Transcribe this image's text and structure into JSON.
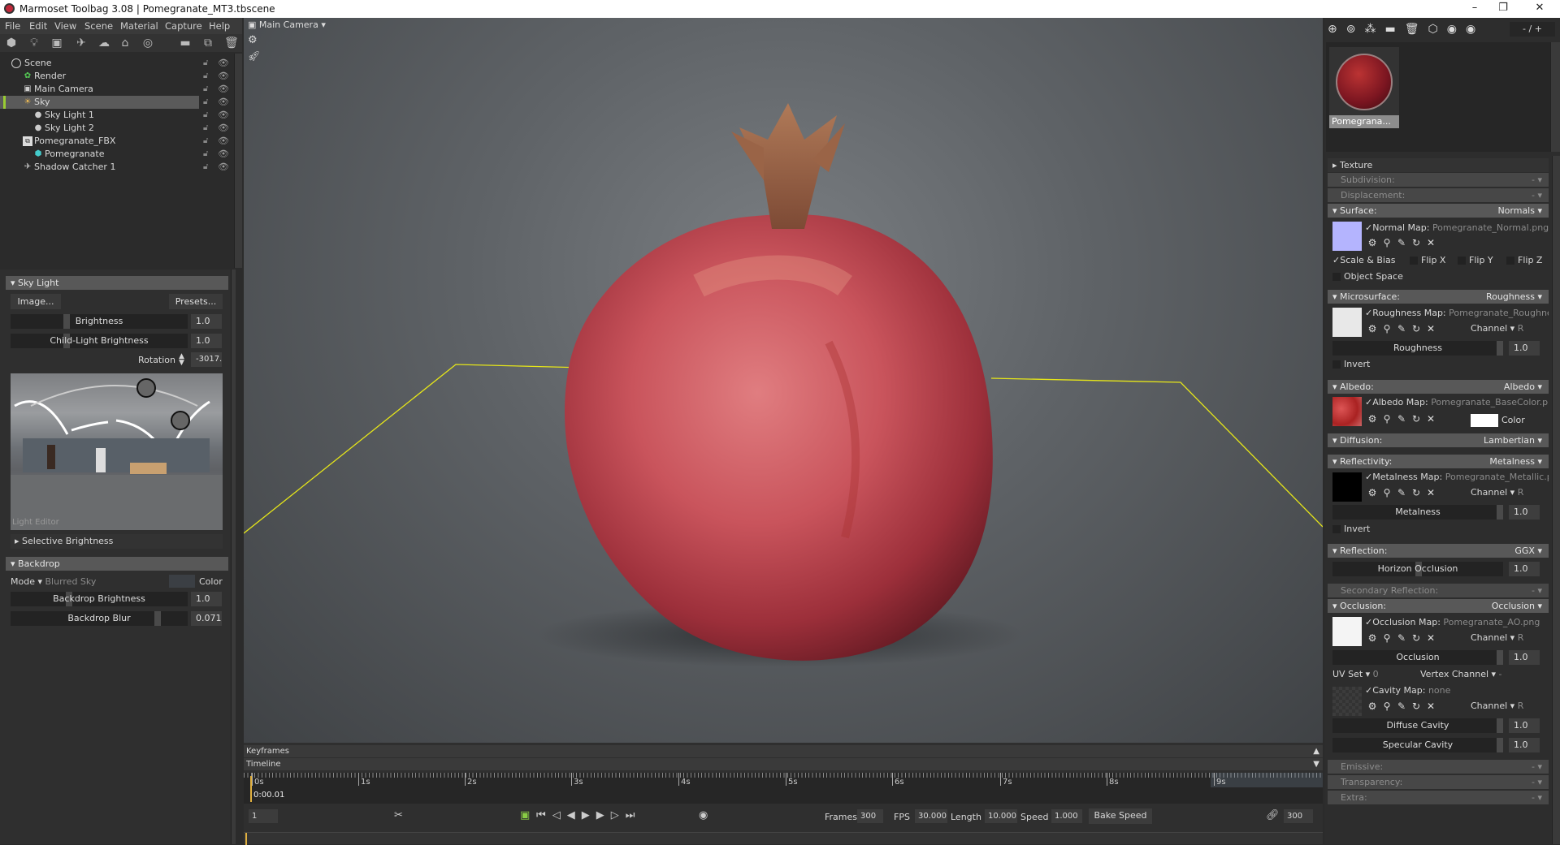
{
  "window": {
    "title": "Marmoset Toolbag 3.08  |  Pomegranate_MT3.tbscene",
    "minimize": "–",
    "restore": "❐",
    "close": "✕"
  },
  "menu": [
    "File",
    "Edit",
    "View",
    "Scene",
    "Material",
    "Capture",
    "Help"
  ],
  "scene_tree": [
    {
      "label": "Scene",
      "icon": "scene-icon"
    },
    {
      "label": "Render",
      "icon": "render-gear-icon"
    },
    {
      "label": "Main Camera",
      "icon": "camera-icon"
    },
    {
      "label": "Sky",
      "icon": "sky-icon",
      "selected": true
    },
    {
      "label": "Sky Light 1",
      "icon": "light-bulb-icon"
    },
    {
      "label": "Sky Light 2",
      "icon": "light-bulb-icon"
    },
    {
      "label": "Pomegranate_FBX",
      "icon": "fbx-icon"
    },
    {
      "label": "Pomegranate",
      "icon": "mesh-icon"
    },
    {
      "label": "Shadow Catcher 1",
      "icon": "shadow-catcher-icon"
    }
  ],
  "sky_light": {
    "title": "Sky Light",
    "image_btn": "Image...",
    "presets_btn": "Presets...",
    "brightness_label": "Brightness",
    "brightness": "1.0",
    "child_label": "Child-Light Brightness",
    "child": "1.0",
    "rotation_label": "Rotation",
    "rotation": "-3017.",
    "light_editor": "Light Editor",
    "selective": "Selective Brightness"
  },
  "backdrop": {
    "title": "Backdrop",
    "mode_label": "Mode",
    "mode": "Blurred Sky",
    "color_label": "Color",
    "brightness_label": "Backdrop Brightness",
    "brightness": "1.0",
    "blur_label": "Backdrop Blur",
    "blur": "0.071",
    "blur_fraction": 0.71
  },
  "viewport": {
    "camera": "Main Camera"
  },
  "material": {
    "page": "- / +",
    "thumb_name": "Pomegrana...",
    "texture": "Texture",
    "subdivision": "Subdivision:",
    "subdivision_v": "-",
    "displacement": "Displacement:",
    "displacement_v": "-",
    "surface": "Surface:",
    "surface_v": "Normals",
    "normal_map_label": "Normal Map:",
    "normal_map": "Pomegranate_Normal.png",
    "scale_bias": "Scale & Bias",
    "flip_x": "Flip X",
    "flip_y": "Flip Y",
    "flip_z": "Flip Z",
    "object_space": "Object Space",
    "microsurface": "Microsurface:",
    "microsurface_v": "Roughness",
    "rough_map_label": "Roughness Map:",
    "rough_map": "Pomegranate_Roughness",
    "channel": "Channel",
    "channel_v": "R",
    "roughness_label": "Roughness",
    "roughness": "1.0",
    "invert": "Invert",
    "albedo": "Albedo:",
    "albedo_v": "Albedo",
    "albedo_map_label": "Albedo Map:",
    "albedo_map": "Pomegranate_BaseColor.png",
    "color": "Color",
    "diffusion": "Diffusion:",
    "diffusion_v": "Lambertian",
    "reflectivity": "Reflectivity:",
    "reflectivity_v": "Metalness",
    "metal_map_label": "Metalness Map:",
    "metal_map": "Pomegranate_Metallic.png",
    "metalness_label": "Metalness",
    "metalness": "1.0",
    "reflection": "Reflection:",
    "reflection_v": "GGX",
    "horizon_label": "Horizon Occlusion",
    "horizon": "1.0",
    "secondary": "Secondary Reflection:",
    "secondary_v": "-",
    "occlusion": "Occlusion:",
    "occlusion_v": "Occlusion",
    "occ_map_label": "Occlusion Map:",
    "occ_map": "Pomegranate_AO.png",
    "occlusion_label": "Occlusion",
    "occlusion_val": "1.0",
    "uv_set": "UV Set",
    "uv_set_v": "0",
    "vertex_channel": "Vertex Channel",
    "vertex_channel_v": "-",
    "cavity_map_label": "Cavity Map:",
    "cavity_map": "none",
    "diffuse_cavity_label": "Diffuse Cavity",
    "diffuse_cavity": "1.0",
    "specular_cavity_label": "Specular Cavity",
    "specular_cavity": "1.0",
    "emissive": "Emissive:",
    "emissive_v": "-",
    "transparency": "Transparency:",
    "transparency_v": "-",
    "extra": "Extra:",
    "extra_v": "-"
  },
  "timeline": {
    "keyframes": "Keyframes",
    "timeline": "Timeline",
    "ticks": [
      "0s",
      "1s",
      "2s",
      "3s",
      "4s",
      "5s",
      "6s",
      "7s",
      "8s",
      "9s"
    ],
    "current_time": "0:00.01",
    "frame": "1",
    "frames_label": "Frames",
    "frames": "300",
    "fps_label": "FPS",
    "fps": "30.000",
    "length_label": "Length",
    "length": "10.000",
    "speed_label": "Speed",
    "speed": "1.000",
    "bake_speed": "Bake Speed",
    "end_frame": "300"
  }
}
